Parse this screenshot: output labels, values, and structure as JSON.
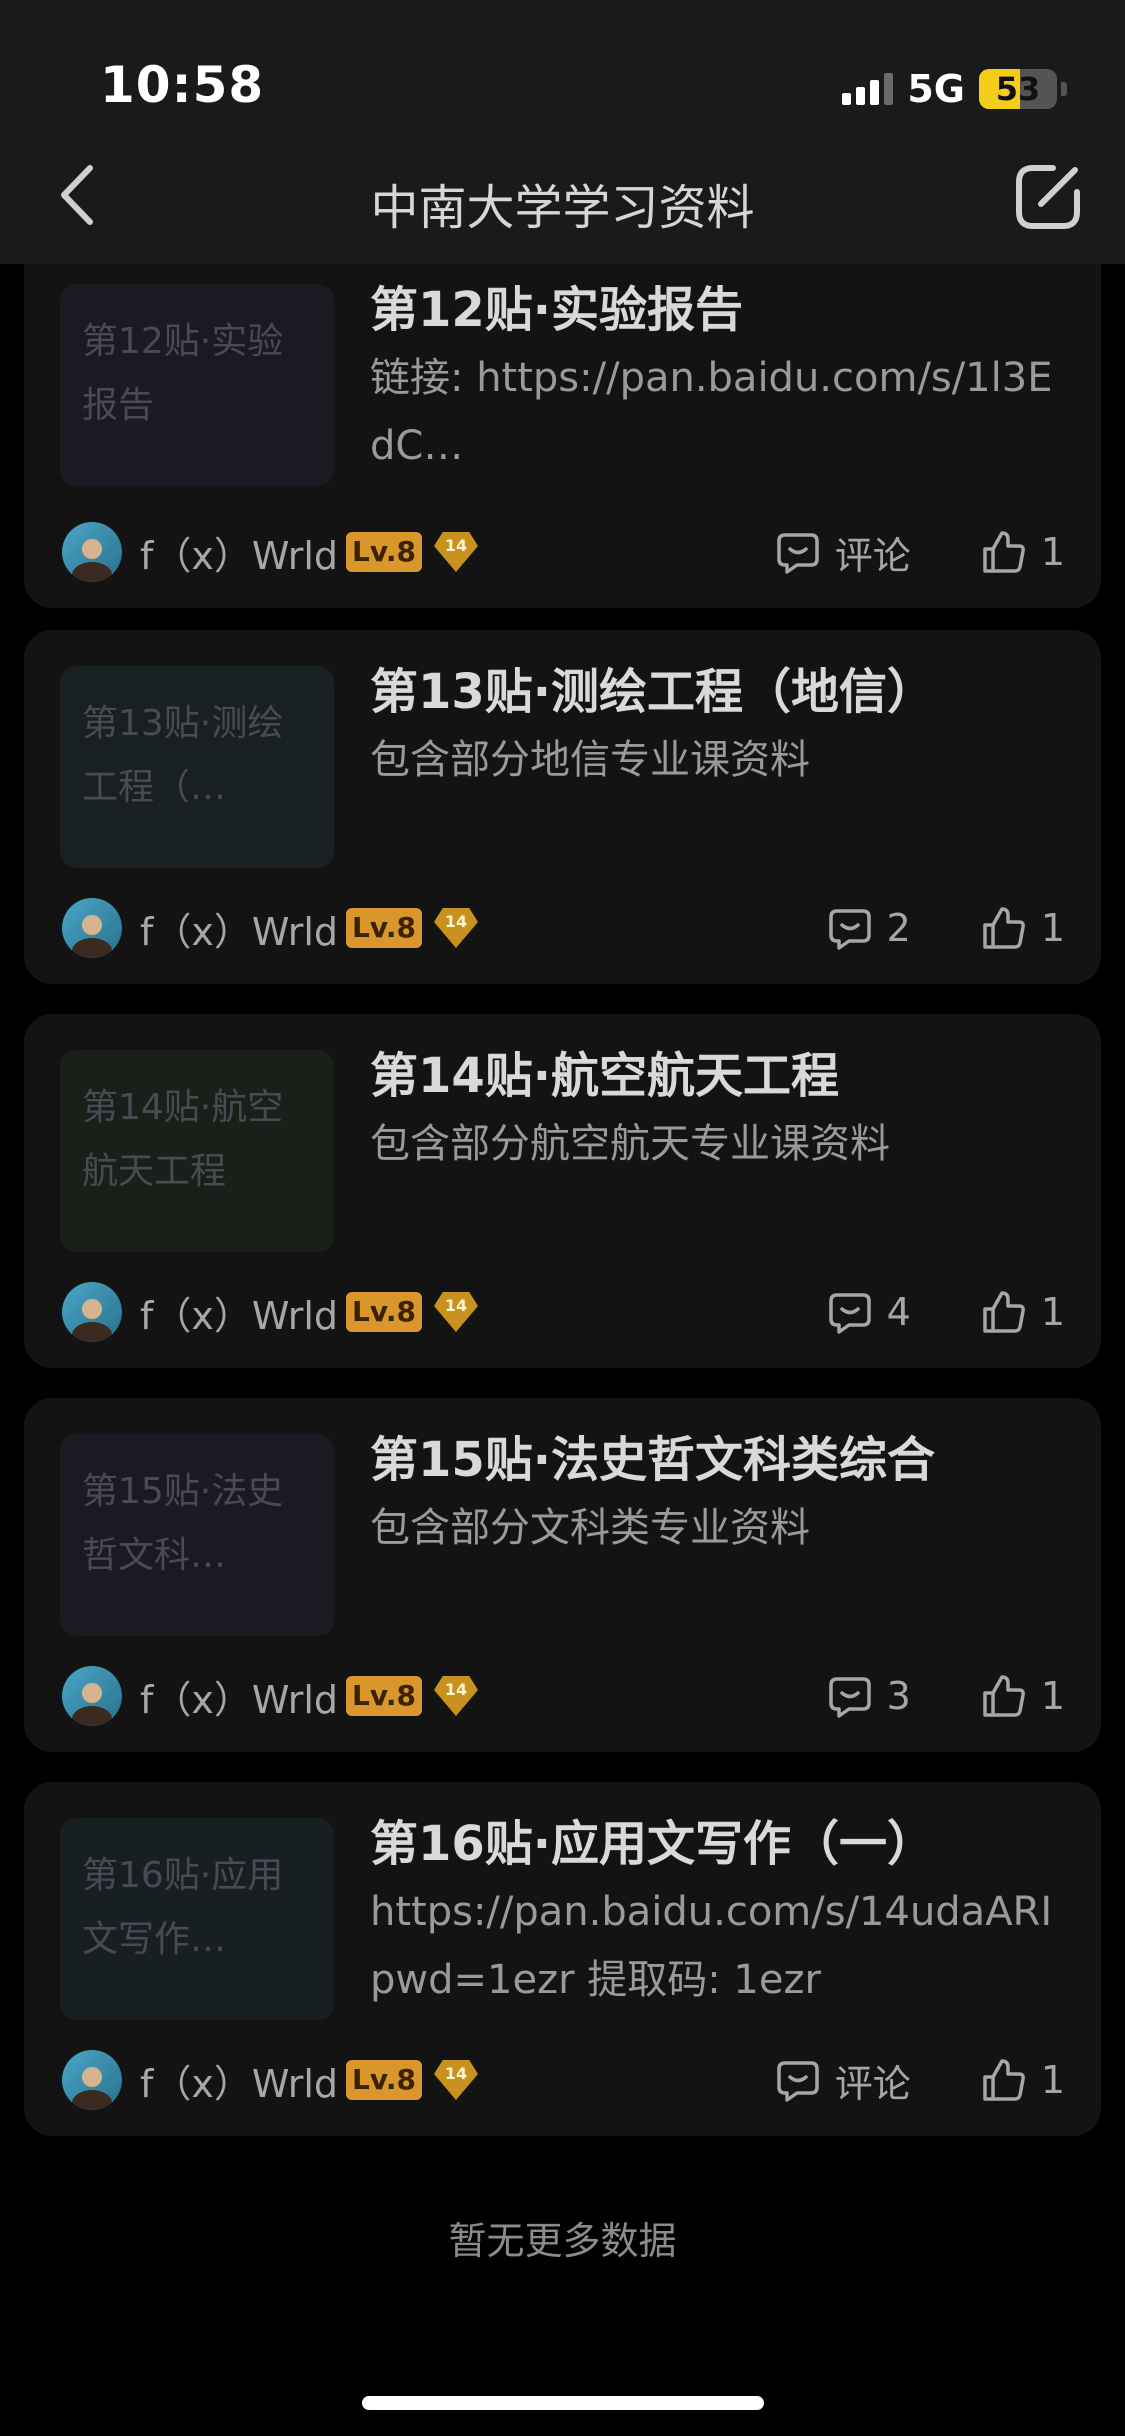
{
  "status_bar": {
    "time": "10:58",
    "network": "5G",
    "battery": "53"
  },
  "nav": {
    "title": "中南大学学习资料",
    "back_icon": "chevron-left-icon",
    "edit_icon": "edit-square-icon"
  },
  "posts": [
    {
      "thumb_text": "第12贴·实验报告",
      "thumb_color": "#1a1a22",
      "title": "第12贴·实验报告",
      "desc": "链接: https://pan.baidu.com/s/1l3EdC…",
      "author": "f（x）Wrld",
      "level": "Lv.8",
      "badge": "14",
      "comments": "评论",
      "likes": "1"
    },
    {
      "thumb_text": "第13贴·测绘工程（…",
      "thumb_color": "#182022",
      "title": "第13贴·测绘工程（地信）",
      "desc": "包含部分地信专业课资料",
      "author": "f（x）Wrld",
      "level": "Lv.8",
      "badge": "14",
      "comments": "2",
      "likes": "1"
    },
    {
      "thumb_text": "第14贴·航空航天工程",
      "thumb_color": "#182019",
      "title": "第14贴·航空航天工程",
      "desc": "包含部分航空航天专业课资料",
      "author": "f（x）Wrld",
      "level": "Lv.8",
      "badge": "14",
      "comments": "4",
      "likes": "1"
    },
    {
      "thumb_text": "第15贴·法史哲文科…",
      "thumb_color": "#1b1a22",
      "title": "第15贴·法史哲文科类综合",
      "desc": "包含部分文科类专业资料",
      "author": "f（x）Wrld",
      "level": "Lv.8",
      "badge": "14",
      "comments": "3",
      "likes": "1"
    },
    {
      "thumb_text": "第16贴·应用文写作…",
      "thumb_color": "#181f22",
      "title": "第16贴·应用文写作（一）",
      "desc": "https://pan.baidu.com/s/14udaARI pwd=1ezr 提取码: 1ezr",
      "author": "f（x）Wrld",
      "level": "Lv.8",
      "badge": "14",
      "comments": "评论",
      "likes": "1"
    }
  ],
  "footer": {
    "no_more": "暂无更多数据"
  },
  "colors": {
    "background": "#000000",
    "card": "#131313",
    "topbar": "#1a1a1a",
    "level_badge": "#d9962a",
    "battery": "#f4cc1a"
  }
}
